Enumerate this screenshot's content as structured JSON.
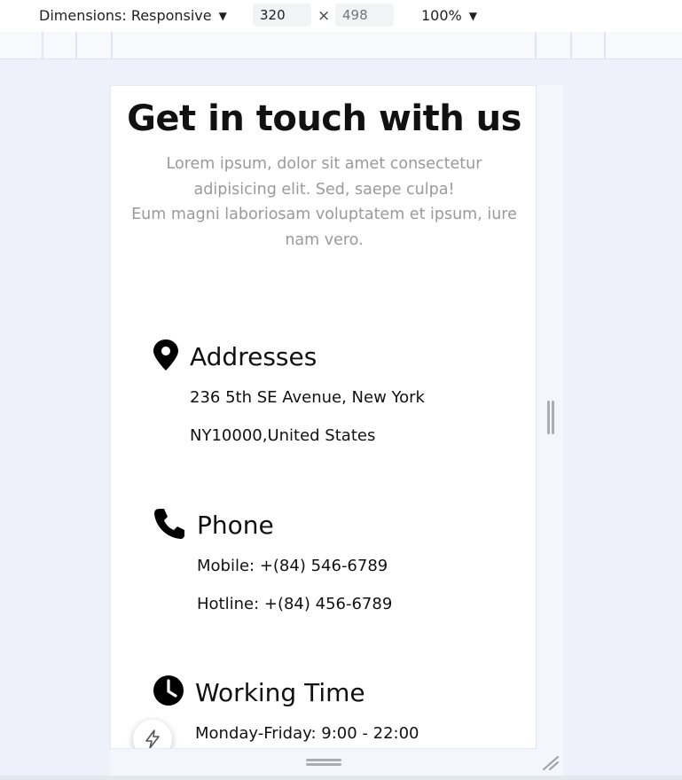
{
  "toolbar": {
    "dimensions_label": "Dimensions: Responsive",
    "width_value": "320",
    "height_placeholder": "498",
    "times_symbol": "×",
    "zoom_label": "100%"
  },
  "page": {
    "title": "Get in touch with us",
    "intro_lines": [
      "Lorem ipsum, dolor sit amet consectetur",
      "adipisicing elit. Sed, saepe culpa!",
      "Eum magni laboriosam voluptatem et ipsum, iure",
      "nam vero."
    ],
    "sections": [
      {
        "title": "Addresses",
        "icon": "map-pin-icon",
        "lines": [
          "236 5th SE Avenue, New York",
          "NY10000,United States"
        ]
      },
      {
        "title": "Phone",
        "icon": "phone-icon",
        "lines": [
          "Mobile: +(84) 546-6789",
          "Hotline: +(84) 456-6789"
        ]
      },
      {
        "title": "Working Time",
        "icon": "clock-icon",
        "lines": [
          "Monday-Friday: 9:00 - 22:00"
        ]
      }
    ]
  },
  "icons": {
    "caret": "dropdown-caret-icon",
    "fab": "lightning-icon",
    "resize": "resize-grip-icon"
  },
  "colors": {
    "toolbar_bg": "#ffffff",
    "workspace_bg": "#eef1f9",
    "heading_text": "#111111",
    "muted_text": "#9a9a9a"
  }
}
